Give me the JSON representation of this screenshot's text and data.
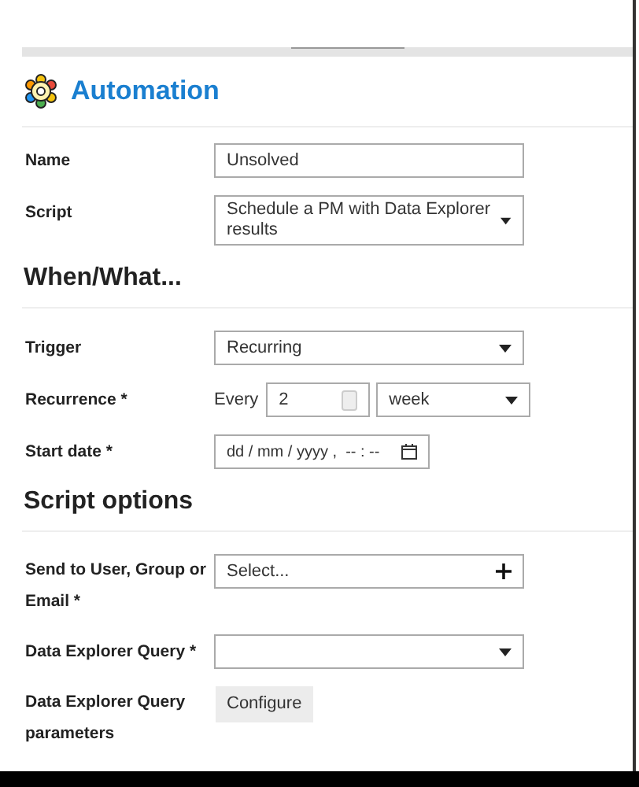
{
  "title": "Automation",
  "fields": [
    {
      "kind": "text",
      "label": "Name",
      "value": "Unsolved"
    },
    {
      "kind": "select",
      "label": "Script",
      "value": "Schedule a PM with Data Explorer results"
    }
  ],
  "sections": [
    {
      "heading": "When/What...",
      "fields": [
        {
          "kind": "select",
          "label": "Trigger",
          "value": "Recurring"
        },
        {
          "kind": "recurrence",
          "label": "Recurrence *",
          "prefix": "Every",
          "number": "2",
          "unit": "week"
        },
        {
          "kind": "datetime",
          "label": "Start date *",
          "placeholder": "dd / mm / yyyy ,  -- : --"
        }
      ]
    },
    {
      "heading": "Script options",
      "fields": [
        {
          "kind": "picker",
          "label": "Send to User, Group or Email *",
          "placeholder": "Select..."
        },
        {
          "kind": "select",
          "label": "Data Explorer Query *"
        },
        {
          "kind": "button",
          "label": "Data Explorer Query parameters",
          "button": "Configure"
        }
      ]
    }
  ]
}
